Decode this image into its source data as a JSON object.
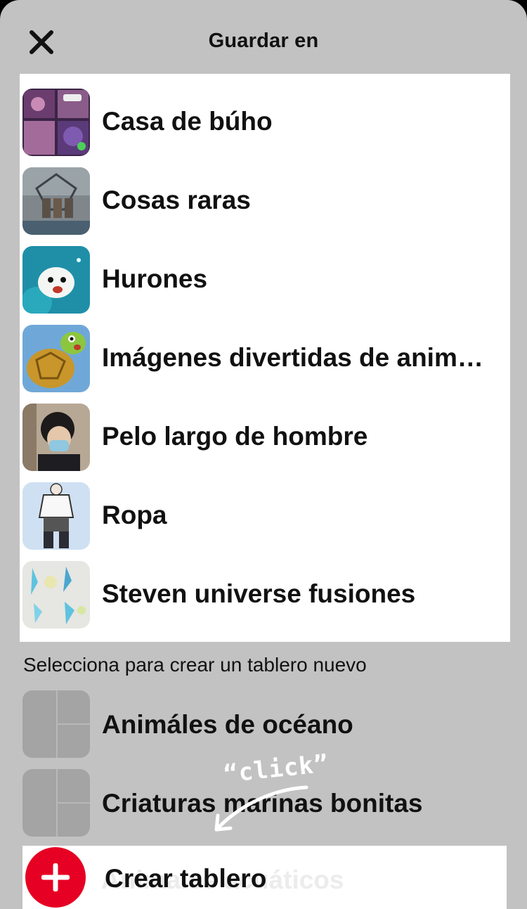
{
  "header": {
    "title": "Guardar en"
  },
  "boards": [
    {
      "name": "Casa de búho"
    },
    {
      "name": "Cosas raras"
    },
    {
      "name": "Hurones"
    },
    {
      "name": "Imágenes divertidas de animales"
    },
    {
      "name": "Pelo largo de hombre"
    },
    {
      "name": "Ropa"
    },
    {
      "name": "Steven universe fusiones"
    }
  ],
  "suggestions": {
    "label": "Selecciona para crear un tablero nuevo",
    "items": [
      {
        "name": "Animáles de océano"
      },
      {
        "name": "Criaturas marinas bonitas"
      },
      {
        "name": "Animales acuáticos"
      }
    ]
  },
  "create": {
    "label": "Crear tablero"
  },
  "overlay": {
    "click_text": "“click”"
  },
  "colors": {
    "accent": "#e60023",
    "sheet_bg": "#c2c2c2",
    "panel_bg": "#ffffff"
  }
}
